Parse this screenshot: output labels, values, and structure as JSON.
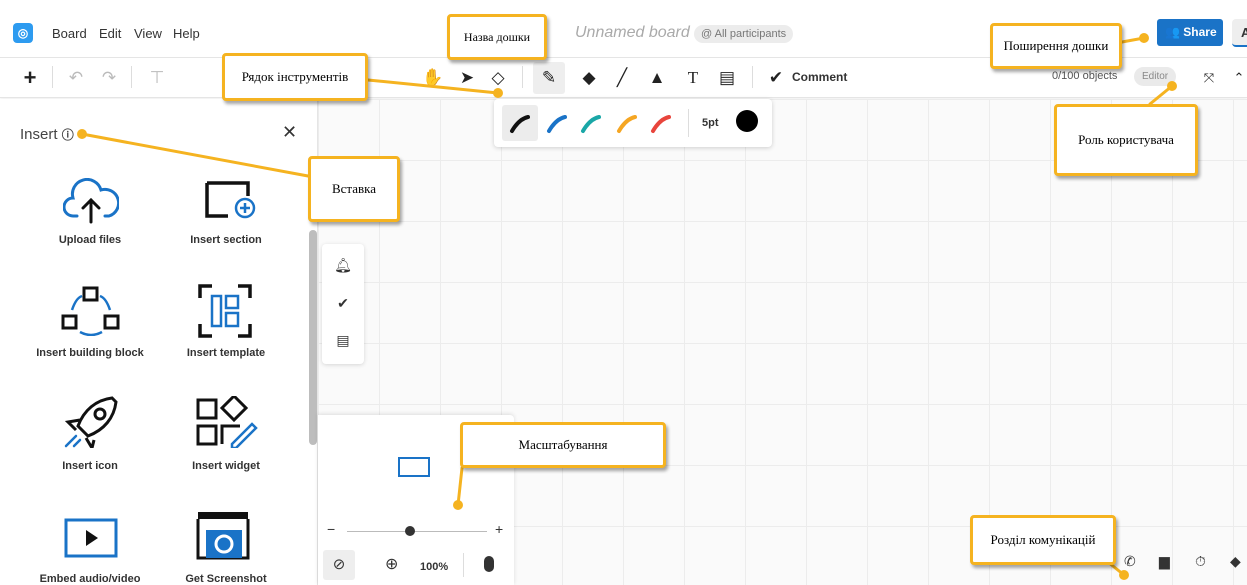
{
  "app": {
    "logo_glyph": "◎",
    "menu": [
      "Board",
      "Edit",
      "View",
      "Help"
    ],
    "board_name_placeholder": "Unnamed board",
    "participants": "@ All participants",
    "share_label": "Share",
    "avatar_initial": "A",
    "accent_color": "#1a73c7"
  },
  "toolbar": {
    "left_icons": [
      "plus-icon",
      "undo-icon",
      "redo-icon",
      "format-painter-icon"
    ],
    "tools": [
      "hand-icon",
      "pointer-icon",
      "eraser-icon",
      "pen-icon",
      "highlighter-icon",
      "line-icon",
      "shapes-icon",
      "text-icon",
      "sticky-note-icon",
      "comment-icon"
    ],
    "comment_label": "Comment",
    "object_count": "0/100 objects",
    "role_badge": "Editor"
  },
  "pen_panel": {
    "pen_colors": [
      "#111111",
      "#1a73c7",
      "#1aa7a7",
      "#f5a623",
      "#e8453c"
    ],
    "size_label": "5pt",
    "current_color": "#000000"
  },
  "insert_panel": {
    "title": "Insert",
    "items": [
      {
        "label": "Upload files",
        "icon": "cloud-upload-icon"
      },
      {
        "label": "Insert section",
        "icon": "section-add-icon"
      },
      {
        "label": "Insert building block",
        "icon": "building-block-icon"
      },
      {
        "label": "Insert template",
        "icon": "template-icon"
      },
      {
        "label": "Insert icon",
        "icon": "rocket-icon"
      },
      {
        "label": "Insert widget",
        "icon": "widget-icon"
      },
      {
        "label": "Embed audio/video",
        "icon": "play-icon"
      },
      {
        "label": "Get Screenshot",
        "icon": "camera-icon"
      }
    ]
  },
  "side_strip": [
    "bell-icon",
    "check-circle-icon",
    "list-icon"
  ],
  "zoom": {
    "minus": "−",
    "plus": "+",
    "level": "100%",
    "slider_fraction": 0.45
  },
  "comms": [
    "phone-icon",
    "presentation-icon",
    "timer-icon",
    "chat-icon"
  ],
  "callouts": {
    "board_name": "Назва дошки",
    "toolbar": "Рядок інструментів",
    "share": "Поширення дошки",
    "role": "Роль користувача",
    "insert": "Вставка",
    "zoom": "Масштабування",
    "comms": "Розділ комунікацій",
    "border_color": "#f5b320"
  }
}
